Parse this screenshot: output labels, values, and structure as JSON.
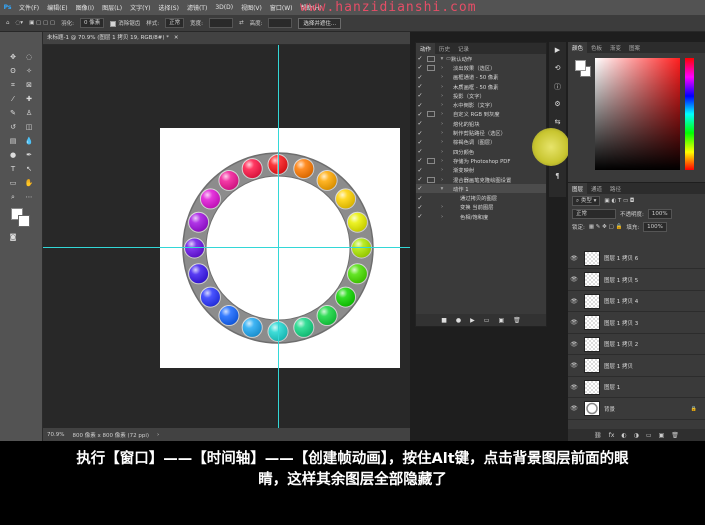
{
  "menubar": {
    "app_icon": "Ps",
    "items": [
      "文件(F)",
      "编辑(E)",
      "图像(I)",
      "图层(L)",
      "文字(Y)",
      "选择(S)",
      "滤镜(T)",
      "3D(D)",
      "视图(V)",
      "窗口(W)",
      "帮助(H)"
    ],
    "watermark": "www.hanzidianshi.com"
  },
  "optbar": {
    "feather_label": "羽化:",
    "feather_value": "0 像素",
    "antialias_label": "消除锯齿",
    "style_label": "样式:",
    "style_value": "正常",
    "width_label": "宽度:",
    "height_label": "高度:",
    "select_button": "选择并遮住..."
  },
  "document": {
    "tab_title": "未标题-1 @ 70.9% (图层 1 拷贝 19, RGB/8#) *",
    "zoom": "70.9%",
    "size": "800 像素 x 800 像素 (72 ppi)"
  },
  "ring": {
    "outer_color": "#8c8c8c",
    "inner_color": "#ffffff",
    "dot_colors": [
      "#f9161a",
      "#ff7a00",
      "#ffa800",
      "#ffd200",
      "#e9f000",
      "#aee900",
      "#49e000",
      "#10d800",
      "#14d840",
      "#15d886",
      "#1ed6d1",
      "#1fa8f2",
      "#1466ff",
      "#2a36ff",
      "#3b19f0",
      "#6a14e8",
      "#a212e2",
      "#e015d6",
      "#f21897",
      "#ff1747"
    ]
  },
  "actions_panel": {
    "tabs": [
      "动作",
      "历史",
      "记录"
    ],
    "rows": [
      {
        "label": "默认动作",
        "checked": true,
        "dialog": true,
        "arrow": "▾",
        "folder": true
      },
      {
        "label": "淡出效果（选区）",
        "checked": true,
        "dialog": true,
        "arrow": "›"
      },
      {
        "label": "画框通道 - 50 像素",
        "checked": true,
        "dialog": false,
        "arrow": "›"
      },
      {
        "label": "木质画框 - 50 像素",
        "checked": true,
        "dialog": false,
        "arrow": "›"
      },
      {
        "label": "投影（文字）",
        "checked": true,
        "dialog": false,
        "arrow": "›"
      },
      {
        "label": "水中倒影（文字）",
        "checked": true,
        "dialog": false,
        "arrow": "›"
      },
      {
        "label": "自定义 RGB 到灰度",
        "checked": true,
        "dialog": true,
        "arrow": "›"
      },
      {
        "label": "熔化的铅块",
        "checked": true,
        "dialog": false,
        "arrow": "›"
      },
      {
        "label": "制作剪贴路径（选区）",
        "checked": true,
        "dialog": false,
        "arrow": "›"
      },
      {
        "label": "棕褐色调（图层）",
        "checked": true,
        "dialog": false,
        "arrow": "›"
      },
      {
        "label": "四分颜色",
        "checked": true,
        "dialog": false,
        "arrow": "›"
      },
      {
        "label": "存储为 Photoshop PDF",
        "checked": true,
        "dialog": true,
        "arrow": "›"
      },
      {
        "label": "渐变映射",
        "checked": true,
        "dialog": false,
        "arrow": "›"
      },
      {
        "label": "混合器画笔克隆绘图设置",
        "checked": true,
        "dialog": true,
        "arrow": "›"
      },
      {
        "label": "动作 1",
        "checked": true,
        "dialog": false,
        "arrow": "▾",
        "selected": true
      },
      {
        "label": "通过拷贝的图层",
        "checked": true,
        "dialog": false,
        "arrow": ""
      },
      {
        "label": "变换 当前图层",
        "checked": true,
        "dialog": false,
        "arrow": "›"
      },
      {
        "label": "色相/饱和度",
        "checked": true,
        "dialog": false,
        "arrow": "›"
      }
    ],
    "bottom_icons": [
      "■",
      "●",
      "▶",
      "▭",
      "▣",
      "🗑"
    ]
  },
  "color_panel": {
    "tabs": [
      "颜色",
      "色板",
      "渐变",
      "图案"
    ],
    "foreground": "#ffffff",
    "background": "#ffffff"
  },
  "layers_panel": {
    "tabs": [
      "图层",
      "通道",
      "路径"
    ],
    "filter_label": "类型",
    "blend_mode": "正常",
    "opacity_label": "不透明度:",
    "opacity_value": "100%",
    "lock_label": "锁定:",
    "fill_label": "填充:",
    "fill_value": "100%",
    "layers": [
      {
        "name": "图层 1 拷贝 6"
      },
      {
        "name": "图层 1 拷贝 5"
      },
      {
        "name": "图层 1 拷贝 4"
      },
      {
        "name": "图层 1 拷贝 3"
      },
      {
        "name": "图层 1 拷贝 2"
      },
      {
        "name": "图层 1 拷贝"
      },
      {
        "name": "图层 1"
      },
      {
        "name": "背景"
      }
    ],
    "bottom_icons": [
      "⛓",
      "fx",
      "◐",
      "◑",
      "▭",
      "▣",
      "🗑"
    ]
  },
  "subtitle": {
    "line1": "执行【窗口】——【时间轴】——【创建帧动画】，按住Alt键，点击背景图层前面的眼",
    "line2": "睛，这样其余图层全部隐藏了"
  }
}
